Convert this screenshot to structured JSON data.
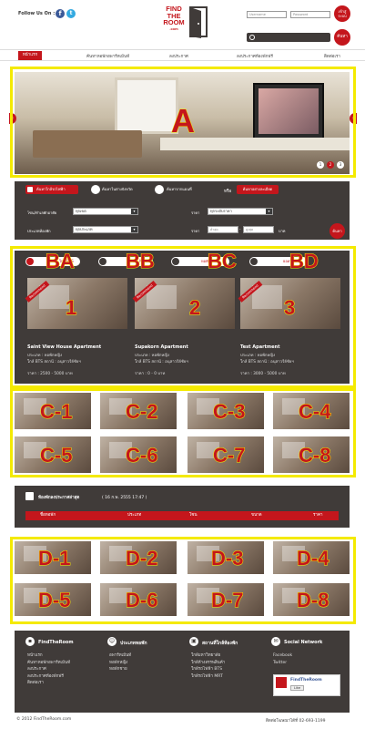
{
  "header": {
    "follow_label": "Follow Us On :",
    "logo_line1": "FIND",
    "logo_line2": "THE",
    "logo_line3": "ROOM",
    "logo_line4": ".com",
    "username_placeholder": "Username",
    "password_placeholder": "Password",
    "login_button": "เข้าสู่ระบบ",
    "search_button": "ค้นหา"
  },
  "nav": {
    "items": [
      "หน้าแรก",
      "ค้นหาหอพักอพาร์ทเม้นท์",
      "ลงประกาศ",
      "ลงประกาศห้องพักฟรี",
      "ติดต่อเรา"
    ]
  },
  "slider": {
    "label": "A",
    "dots": [
      "1",
      "2",
      "3"
    ]
  },
  "search_panel": {
    "tabs": [
      "ค้นหาใกล้รถไฟฟ้า",
      "ค้นหาในต่างจังหวัด",
      "ค้นหาจากแผนที่",
      "หรือ",
      "ค้นหาอย่างละเอียด"
    ],
    "field_zone_label": "โซน/ทำเลพักอาศัย",
    "field_zone_value": "ทุกเขต",
    "field_type_label": "ประเภทห้องพัก",
    "field_type_value": "ทุกประเภท",
    "field_price_label": "ราคา",
    "field_price_value": "ทุกระดับราคา",
    "field_range_label": "ราคา",
    "range_from": "ต่ำสุด",
    "range_to": "สูงสุด",
    "range_unit": "บาท",
    "submit": "ค้นหา"
  },
  "featured": {
    "tabs": [
      {
        "label": "BA",
        "text": "ใกล้ BTS",
        "icon": "home-icon"
      },
      {
        "label": "BB",
        "text": "ใกล้ MRT",
        "icon": "eye-icon"
      },
      {
        "label": "BC",
        "text": "หอพักใหม่",
        "icon": "tag-icon"
      },
      {
        "label": "BD",
        "text": "ยอดนิยม",
        "icon": "star-icon"
      }
    ],
    "cards": [
      {
        "num": "1",
        "badge": "Recommend",
        "title": "Saint View House Apartment",
        "line1": "ประเภท : หอพักหญิง",
        "line2": "ใกล้ BTS สถานี : อนุสาวรีย์ชัยฯ",
        "price": "ราคา : 2500 - 5000 บาท"
      },
      {
        "num": "2",
        "badge": "Recommend",
        "title": "Supakorn Apartment",
        "line1": "ประเภท : หอพักหญิง",
        "line2": "ใกล้ BTS สถานี : อนุสาวรีย์ชัยฯ",
        "price": "ราคา : 0 - 0 บาท"
      },
      {
        "num": "3",
        "badge": "Recommend",
        "title": "Test Apartment",
        "line1": "ประเภท : หอพักหญิง",
        "line2": "ใกล้ BTS สถานี : อนุสาวรีย์ชัยฯ",
        "price": "ราคา : 3000 - 5000 บาท"
      }
    ]
  },
  "gallery_c": [
    "C-1",
    "C-2",
    "C-3",
    "C-4",
    "C-5",
    "C-6",
    "C-7",
    "C-8"
  ],
  "latest": {
    "title": "ห้องพักลงประกาศล่าสุด",
    "timestamp": "( 16 ก.พ. 2555 17:47 )",
    "columns": [
      "ชื่อหอพัก",
      "ประเภท",
      "โซน",
      "ขนาด",
      "ราคา"
    ]
  },
  "gallery_d": [
    "D-1",
    "D-2",
    "D-3",
    "D-4",
    "D-5",
    "D-6",
    "D-7",
    "D-8"
  ],
  "footer": {
    "col1_title": "FindTheRoom",
    "col1_links": [
      "หน้าแรก",
      "ค้นหาหอพักอพาร์ทเม้นท์",
      "ลงประกาศ",
      "ลงประกาศห้องพักฟรี",
      "ติดต่อเรา"
    ],
    "col2_title": "ประเภทหอพัก",
    "col2_links": [
      "อพาร์ทเม้นท์",
      "หอพักหญิง",
      "หอพักชาย"
    ],
    "col3_title": "สถานที่ใกล้ห้องพัก",
    "col3_links": [
      "ใกล้มหาวิทยาลัย",
      "ใกล้ห้างสรรพสินค้า",
      "ใกล้รถไฟฟ้า BTS",
      "ใกล้รถไฟฟ้า MRT"
    ],
    "col4_title": "Social Network",
    "col4_links": [
      "Facebook",
      "Twitter"
    ],
    "fb_box_title": "FindTheRoom",
    "fb_like": "Like",
    "copyright": "© 2012 FindTheRoom.com",
    "contact": "ติดต่อโฆษณาได้ที่ 02-693-1199"
  }
}
